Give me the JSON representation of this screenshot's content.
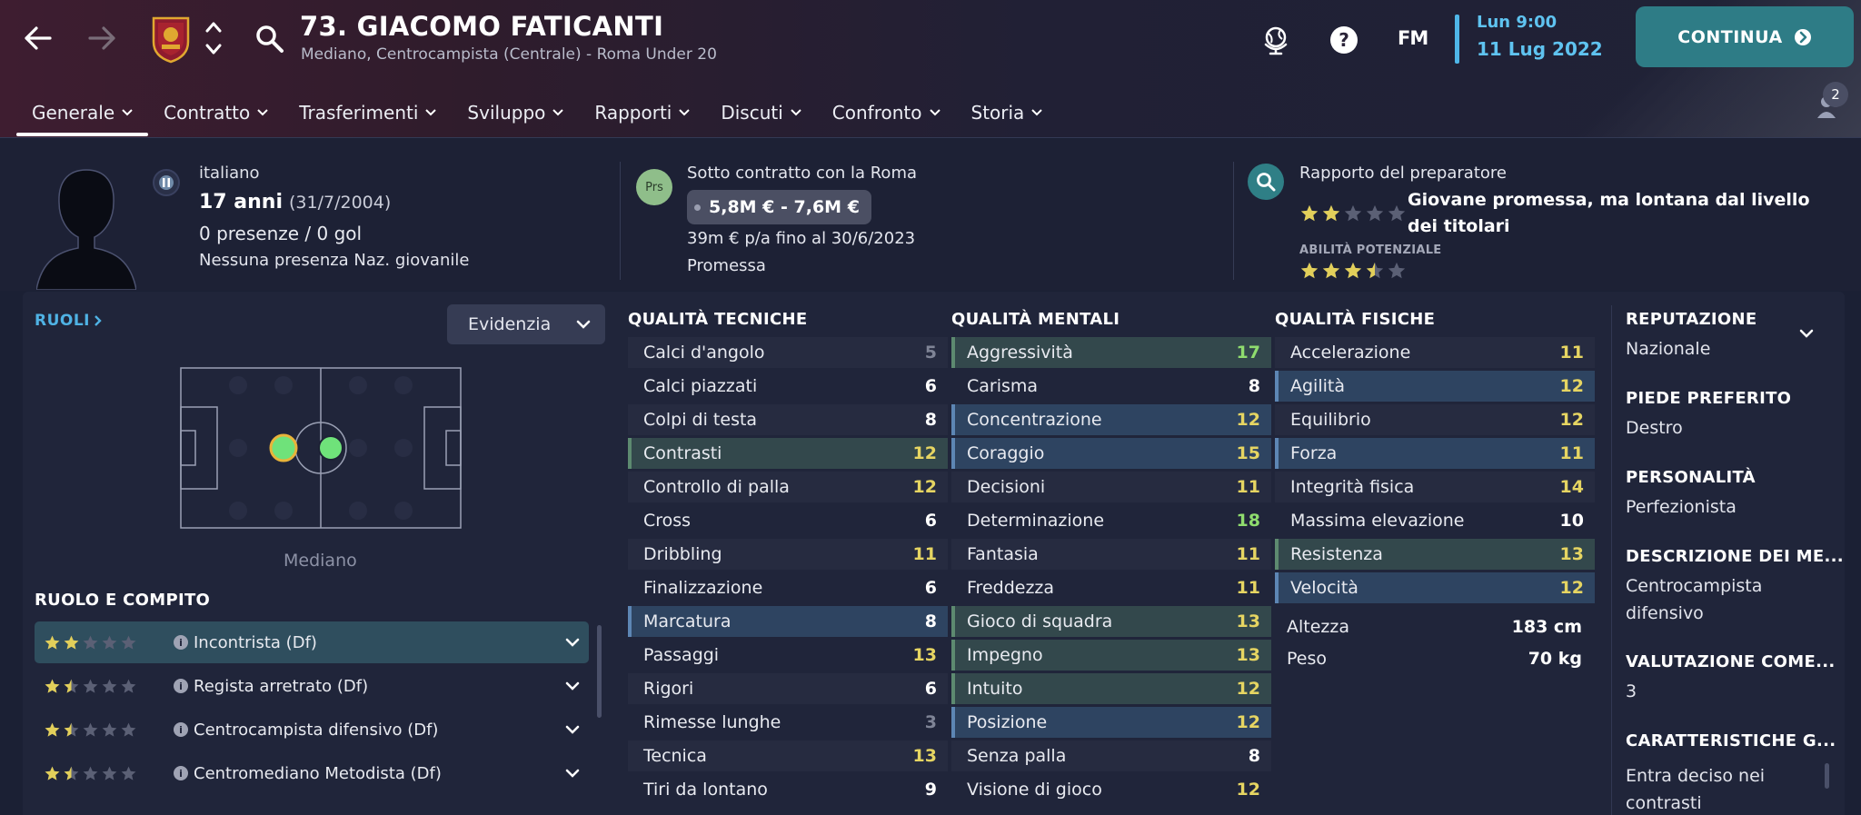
{
  "header": {
    "title": "73. GIACOMO FATICANTI",
    "subtitle": "Mediano, Centrocampista (Centrale) - Roma Under 20",
    "logo": "FM",
    "date_time": "Lun 9:00",
    "date_day": "11 Lug 2022",
    "continue_label": "CONTINUA",
    "notification_count": "2",
    "icons": [
      "back-arrow-icon",
      "forward-arrow-icon",
      "club-crest-icon",
      "up-down-icon",
      "search-icon",
      "globe-icon",
      "help-icon",
      "people-icon"
    ]
  },
  "tabs": [
    {
      "label": "Generale",
      "active": true
    },
    {
      "label": "Contratto"
    },
    {
      "label": "Trasferimenti"
    },
    {
      "label": "Sviluppo"
    },
    {
      "label": "Rapporti"
    },
    {
      "label": "Discuti"
    },
    {
      "label": "Confronto"
    },
    {
      "label": "Storia"
    }
  ],
  "info": {
    "nationality": "italiano",
    "age": "17 anni",
    "dob": "(31/7/2004)",
    "appearances": "0 presenze / 0 gol",
    "youth_caps": "Nessuna presenza Naz. giovanile",
    "status_badge": "Prs",
    "contract": "Sotto contratto con la Roma",
    "value": "5,8M € - 7,6M €",
    "wage": "39m € p/a fino al 30/6/2023",
    "status": "Promessa",
    "scout_heading": "Rapporto del preparatore",
    "scout_verdict": "Giovane promessa, ma lontana dal livello dei titolari",
    "current_ability_stars": 2,
    "potential_label": "ABILITÀ POTENZIALE",
    "potential_ability_stars": 3.5
  },
  "roles": {
    "heading": "RUOLI",
    "dropdown": "Evidenzia",
    "position_label": "Mediano",
    "section_heading": "RUOLO E COMPITO",
    "items": [
      {
        "label": "Incontrista (Df)",
        "stars": 2,
        "selected": true
      },
      {
        "label": "Regista arretrato (Df)",
        "stars": 1.5
      },
      {
        "label": "Centrocampista difensivo (Df)",
        "stars": 1.5
      },
      {
        "label": "Centromediano Metodista (Df)",
        "stars": 1.5
      }
    ]
  },
  "technical": {
    "heading": "QUALITÀ TECNICHE",
    "attrs": [
      {
        "name": "Calci d'angolo",
        "value": "5",
        "hl": ""
      },
      {
        "name": "Calci piazzati",
        "value": "6",
        "hl": ""
      },
      {
        "name": "Colpi di testa",
        "value": "8",
        "hl": ""
      },
      {
        "name": "Contrasti",
        "value": "12",
        "hl": "green"
      },
      {
        "name": "Controllo di palla",
        "value": "12",
        "hl": ""
      },
      {
        "name": "Cross",
        "value": "6",
        "hl": ""
      },
      {
        "name": "Dribbling",
        "value": "11",
        "hl": ""
      },
      {
        "name": "Finalizzazione",
        "value": "6",
        "hl": ""
      },
      {
        "name": "Marcatura",
        "value": "8",
        "hl": "blue"
      },
      {
        "name": "Passaggi",
        "value": "13",
        "hl": ""
      },
      {
        "name": "Rigori",
        "value": "6",
        "hl": ""
      },
      {
        "name": "Rimesse lunghe",
        "value": "3",
        "hl": ""
      },
      {
        "name": "Tecnica",
        "value": "13",
        "hl": ""
      },
      {
        "name": "Tiri da lontano",
        "value": "9",
        "hl": ""
      }
    ]
  },
  "mental": {
    "heading": "QUALITÀ MENTALI",
    "attrs": [
      {
        "name": "Aggressività",
        "value": "17",
        "hl": "green"
      },
      {
        "name": "Carisma",
        "value": "8",
        "hl": ""
      },
      {
        "name": "Concentrazione",
        "value": "12",
        "hl": "blue"
      },
      {
        "name": "Coraggio",
        "value": "15",
        "hl": "blue"
      },
      {
        "name": "Decisioni",
        "value": "11",
        "hl": ""
      },
      {
        "name": "Determinazione",
        "value": "18",
        "hl": ""
      },
      {
        "name": "Fantasia",
        "value": "11",
        "hl": ""
      },
      {
        "name": "Freddezza",
        "value": "11",
        "hl": ""
      },
      {
        "name": "Gioco di squadra",
        "value": "13",
        "hl": "green"
      },
      {
        "name": "Impegno",
        "value": "13",
        "hl": "green"
      },
      {
        "name": "Intuito",
        "value": "12",
        "hl": "green"
      },
      {
        "name": "Posizione",
        "value": "12",
        "hl": "blue"
      },
      {
        "name": "Senza palla",
        "value": "8",
        "hl": ""
      },
      {
        "name": "Visione di gioco",
        "value": "12",
        "hl": ""
      }
    ]
  },
  "physical": {
    "heading": "QUALITÀ FISICHE",
    "attrs": [
      {
        "name": "Accelerazione",
        "value": "11",
        "hl": ""
      },
      {
        "name": "Agilità",
        "value": "12",
        "hl": "blue"
      },
      {
        "name": "Equilibrio",
        "value": "12",
        "hl": ""
      },
      {
        "name": "Forza",
        "value": "11",
        "hl": "blue"
      },
      {
        "name": "Integrità fisica",
        "value": "14",
        "hl": ""
      },
      {
        "name": "Massima elevazione",
        "value": "10",
        "hl": ""
      },
      {
        "name": "Resistenza",
        "value": "13",
        "hl": "green"
      },
      {
        "name": "Velocità",
        "value": "12",
        "hl": "blue"
      }
    ],
    "height_label": "Altezza",
    "height": "183 cm",
    "weight_label": "Peso",
    "weight": "70 kg"
  },
  "side": [
    {
      "heading": "REPUTAZIONE",
      "value": "Nazionale"
    },
    {
      "heading": "PIEDE PREFERITO",
      "value": "Destro"
    },
    {
      "heading": "PERSONALITÀ",
      "value": "Perfezionista"
    },
    {
      "heading": "DESCRIZIONE DEI ME...",
      "value": "Centrocampista difensivo"
    },
    {
      "heading": "VALUTAZIONE COME...",
      "value": "3"
    },
    {
      "heading": "CARATTERISTICHE G...",
      "value": "Entra deciso nei contrasti"
    }
  ],
  "colors": {
    "accent": "#2e7c86",
    "date": "#5fc3f0",
    "star": "#e2cf5a",
    "value_yellow": "#e6d562",
    "value_green": "#8fdc6e",
    "highlight_green": "#33484c",
    "highlight_blue": "#2e4461"
  }
}
